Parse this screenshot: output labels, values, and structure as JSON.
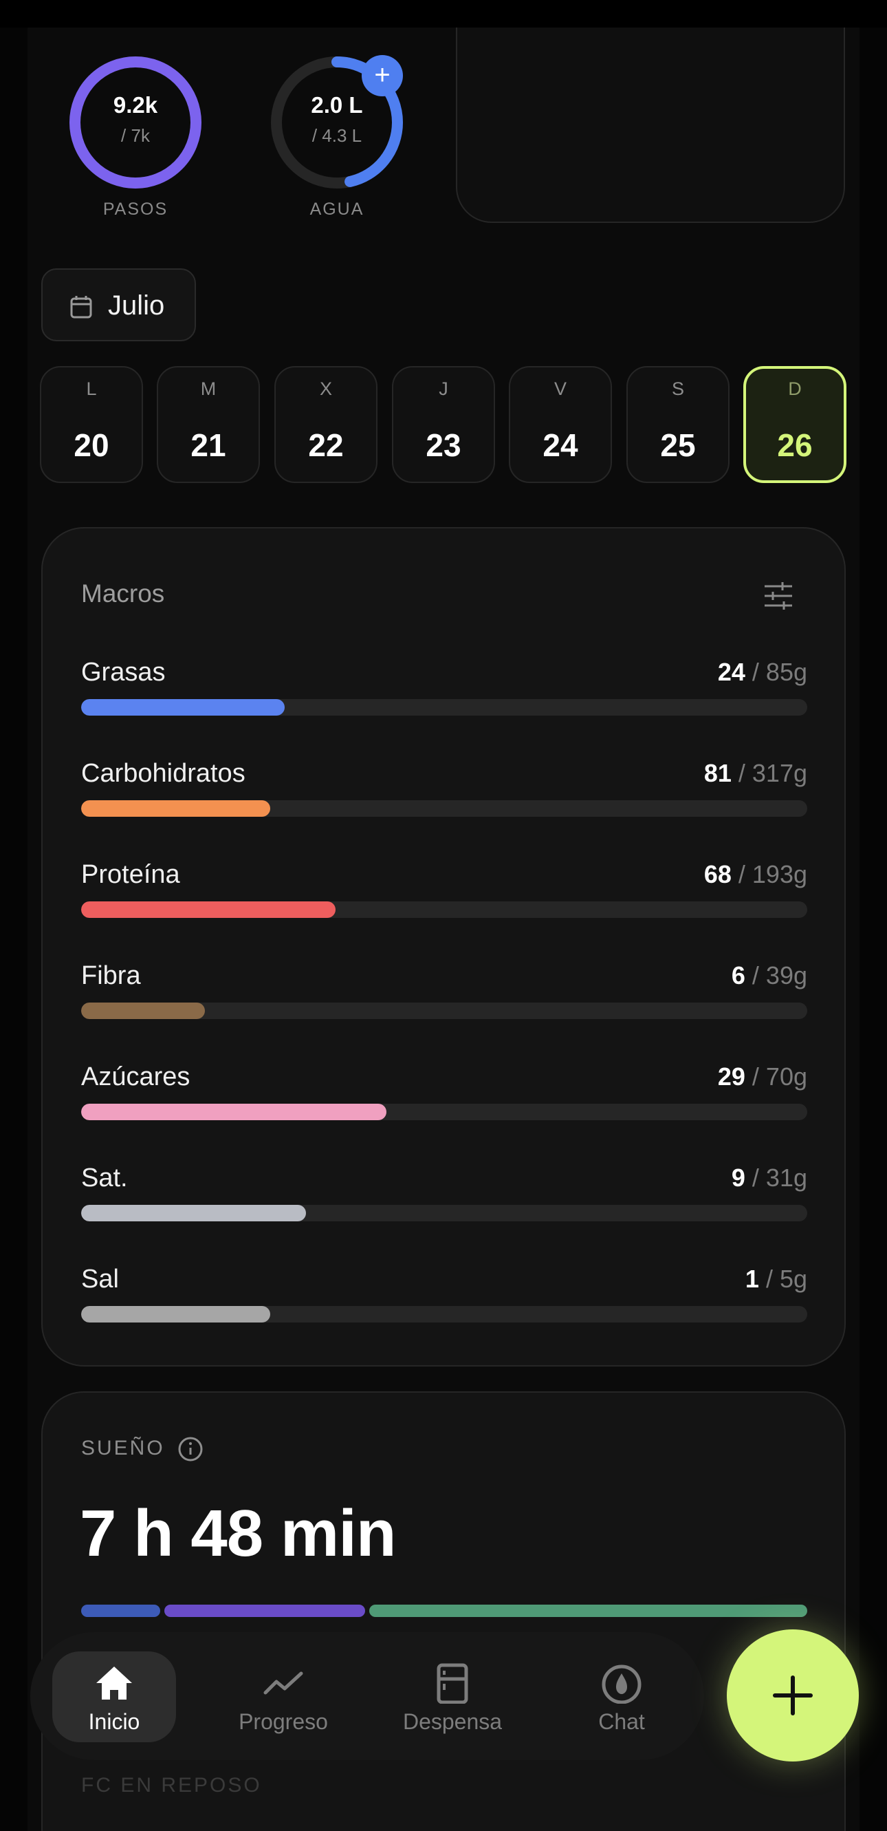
{
  "rings": {
    "steps": {
      "value": "9.2k",
      "goal": "/ 7k",
      "label": "PASOS",
      "progress": 1.0,
      "color": "#7c63ee"
    },
    "water": {
      "value": "2.0 L",
      "goal": "/ 4.3 L",
      "label": "AGUA",
      "progress": 0.465,
      "color": "#4f7ff0",
      "add_icon": "plus-icon"
    }
  },
  "month": {
    "label": "Julio",
    "icon": "calendar-icon"
  },
  "days": [
    {
      "letter": "L",
      "num": "20"
    },
    {
      "letter": "M",
      "num": "21"
    },
    {
      "letter": "X",
      "num": "22"
    },
    {
      "letter": "J",
      "num": "23"
    },
    {
      "letter": "V",
      "num": "24"
    },
    {
      "letter": "S",
      "num": "25"
    },
    {
      "letter": "D",
      "num": "26",
      "selected": true
    }
  ],
  "macros": {
    "title": "Macros",
    "filter_icon": "sliders-icon",
    "items": [
      {
        "name": "Grasas",
        "current": "24",
        "total": " / 85g",
        "progress": 0.28,
        "color": "#5b83f0"
      },
      {
        "name": "Carbohidratos",
        "current": "81",
        "total": " / 317g",
        "progress": 0.26,
        "color": "#f39150"
      },
      {
        "name": "Proteína",
        "current": "68",
        "total": " / 193g",
        "progress": 0.35,
        "color": "#ee5e5e"
      },
      {
        "name": "Fibra",
        "current": "6",
        "total": " / 39g",
        "progress": 0.17,
        "color": "#8a6a48"
      },
      {
        "name": "Azúcares",
        "current": "29",
        "total": " / 70g",
        "progress": 0.42,
        "color": "#f0a0c0"
      },
      {
        "name": "Sat.",
        "current": "9",
        "total": " / 31g",
        "progress": 0.31,
        "color": "#b9bcc4"
      },
      {
        "name": "Sal",
        "current": "1",
        "total": " / 5g",
        "progress": 0.26,
        "color": "#a6a6a6"
      }
    ]
  },
  "sleep": {
    "label": "SUEÑO",
    "info_icon": "info-icon",
    "duration": "7 h 48 min",
    "phases": [
      {
        "name": "deep",
        "fraction": 0.11,
        "color": "#3d5bb8"
      },
      {
        "name": "rem",
        "fraction": 0.28,
        "color": "#6a4cc8"
      },
      {
        "name": "light",
        "fraction": 0.61,
        "color": "#4f9a76"
      }
    ]
  },
  "next_card_label": "FC EN REPOSO",
  "nav": {
    "items": [
      {
        "label": "Inicio",
        "icon": "home-icon",
        "active": true
      },
      {
        "label": "Progreso",
        "icon": "trend-icon"
      },
      {
        "label": "Despensa",
        "icon": "fridge-icon"
      },
      {
        "label": "Chat",
        "icon": "flame-icon"
      }
    ],
    "fab_icon": "plus-icon"
  }
}
